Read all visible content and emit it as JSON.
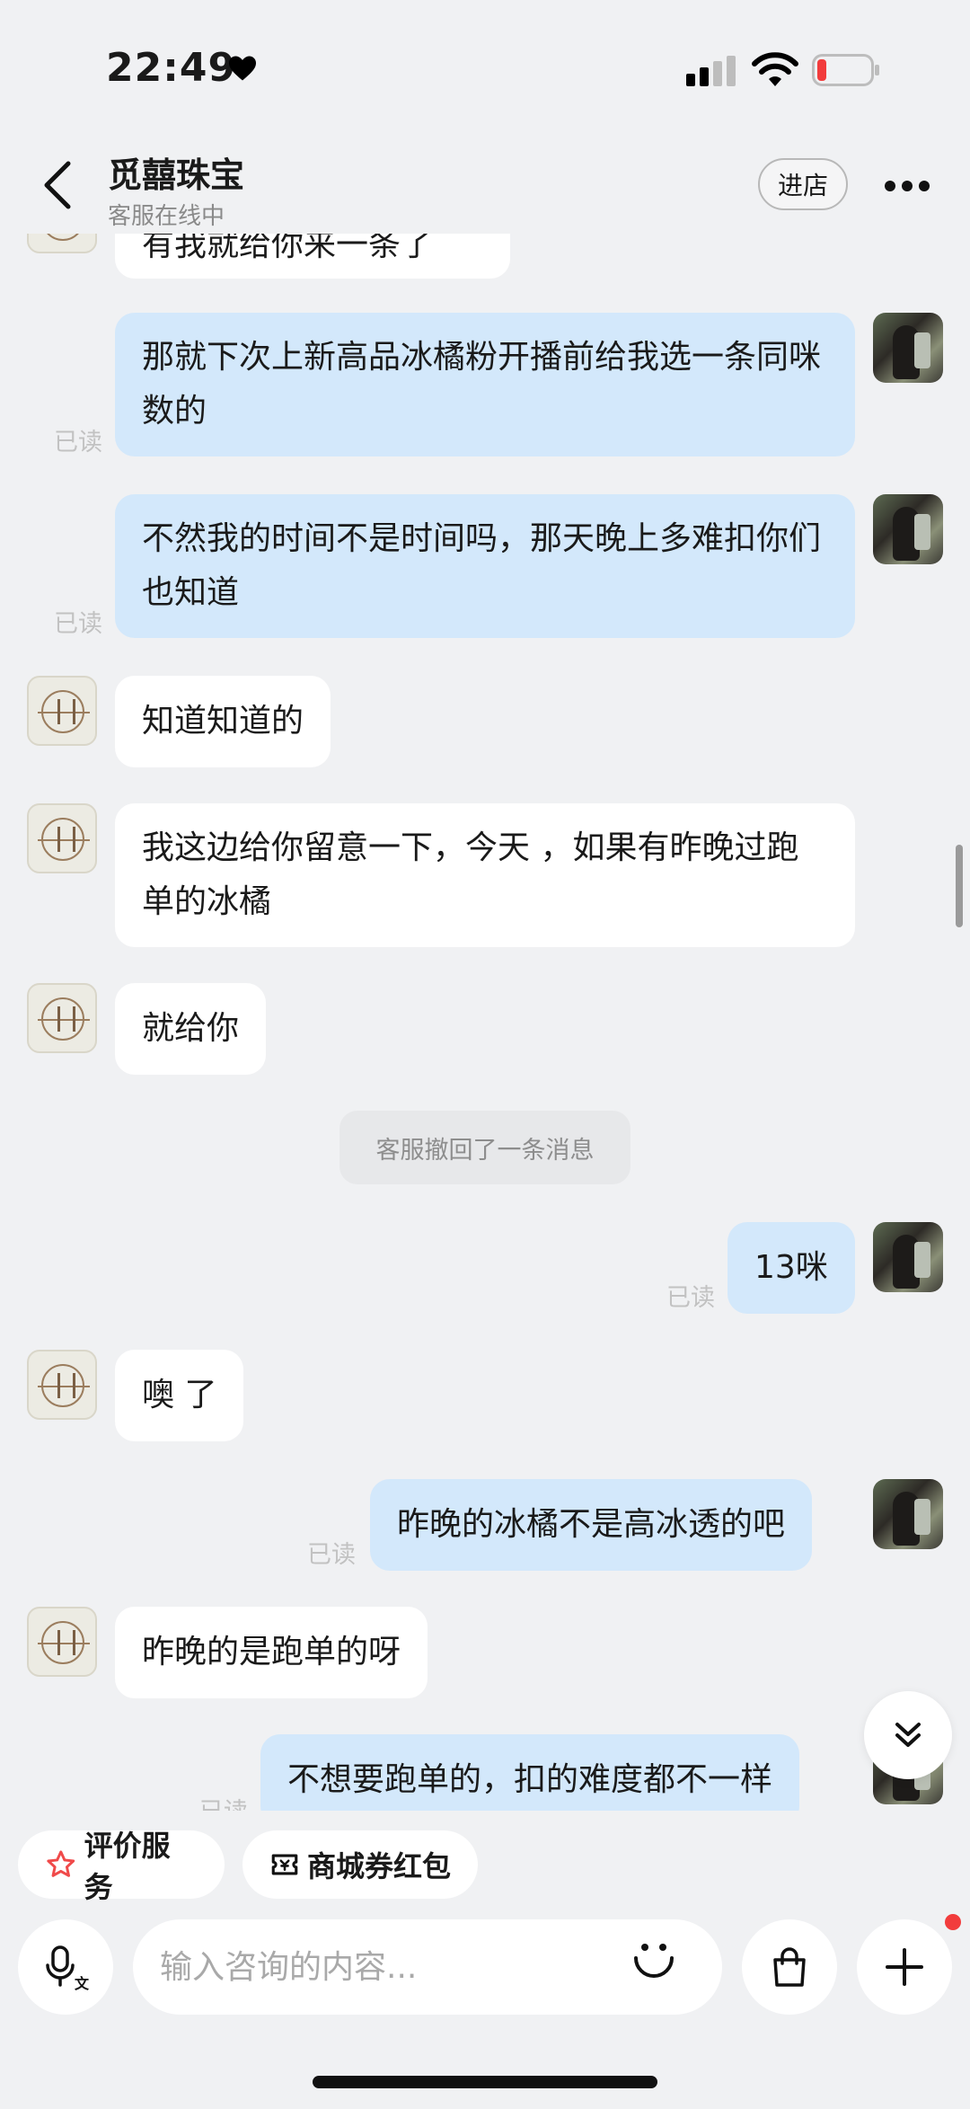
{
  "status_bar": {
    "time": "22:49"
  },
  "header": {
    "shop_name": "觅囍珠宝",
    "status": "客服在线中",
    "enter_shop": "进店"
  },
  "messages": {
    "m0": "有我就给你来一条了",
    "m1": "那就下次上新高品冰橘粉开播前给我选一条同咪数的",
    "m2": "不然我的时间不是时间吗，那天晚上多难扣你们也知道",
    "m3": "知道知道的",
    "m4": "我这边给你留意一下，今天 ，如果有昨晚过跑单的冰橘",
    "m5": "就给你",
    "m6": "13咪",
    "m7": "噢 了",
    "m8": "昨晚的冰橘不是高冰透的吧",
    "m9": "昨晚的是跑单的呀",
    "m10": "不想要跑单的，扣的难度都不一样"
  },
  "read_label": "已读",
  "system_message": "客服撤回了一条消息",
  "quick_actions": {
    "rate": "评价服务",
    "coupon": "商城券红包"
  },
  "input": {
    "placeholder": "输入咨询的内容..."
  },
  "colors": {
    "user_bubble": "#d3e8fb",
    "shop_bubble": "#ffffff",
    "background": "#f0f1f3",
    "badge": "#f23c3c"
  },
  "icons": [
    "heart-icon",
    "signal-icon",
    "wifi-icon",
    "battery-icon",
    "back-icon",
    "more-icon",
    "star-icon",
    "coupon-icon",
    "voice-icon",
    "emoji-icon",
    "bag-icon",
    "plus-icon",
    "chevron-down-double-icon"
  ]
}
